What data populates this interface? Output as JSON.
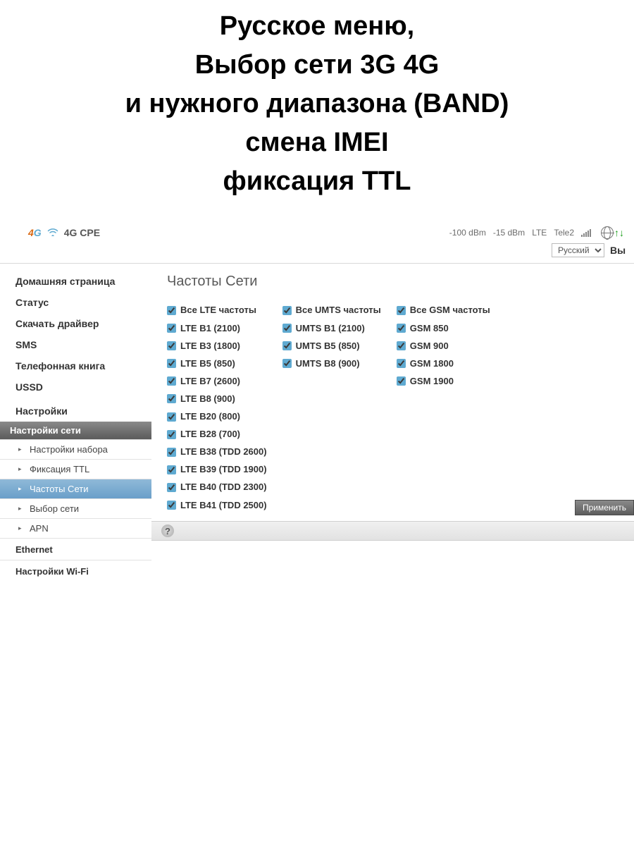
{
  "promo": {
    "line1": "Русское меню,",
    "line2": "Выбор сети 3G 4G",
    "line3": "и нужного диапазона (BAND)",
    "line4": "смена IMEI",
    "line5": "фиксация TTL"
  },
  "toolbar": {
    "logo_4": "4",
    "logo_g": "G",
    "device_name": "4G CPE",
    "signal_dbm1": "-100 dBm",
    "signal_dbm2": "-15 dBm",
    "network_mode": "LTE",
    "operator": "Tele2",
    "globe_arrows": "↑↓"
  },
  "lang": {
    "selected": "Русский",
    "extra": "Вы"
  },
  "sidebar": {
    "items": [
      "Домашняя страница",
      "Статус",
      "Скачать драйвер",
      "SMS",
      "Телефонная книга",
      "USSD",
      "Настройки"
    ],
    "group1": {
      "header": "Настройки сети",
      "items": [
        "Настройки набора",
        "Фиксация TTL",
        "Частоты Сети",
        "Выбор сети",
        "APN"
      ],
      "active_index": 2
    },
    "group2": {
      "header": "Ethernet"
    },
    "group3": {
      "header": "Настройки Wi-Fi"
    }
  },
  "page": {
    "title": "Частоты Сети",
    "apply": "Применить",
    "help": "?"
  },
  "bands": {
    "lte": [
      "Все LTE частоты",
      "LTE B1 (2100)",
      "LTE B3 (1800)",
      "LTE B5 (850)",
      "LTE B7 (2600)",
      "LTE B8 (900)",
      "LTE B20 (800)",
      "LTE B28 (700)",
      "LTE B38 (TDD 2600)",
      "LTE B39 (TDD 1900)",
      "LTE B40 (TDD 2300)",
      "LTE B41 (TDD 2500)"
    ],
    "umts": [
      "Все UMTS частоты",
      "UMTS B1 (2100)",
      "UMTS B5 (850)",
      "UMTS B8 (900)"
    ],
    "gsm": [
      "Все GSM частоты",
      "GSM 850",
      "GSM 900",
      "GSM 1800",
      "GSM 1900"
    ]
  }
}
